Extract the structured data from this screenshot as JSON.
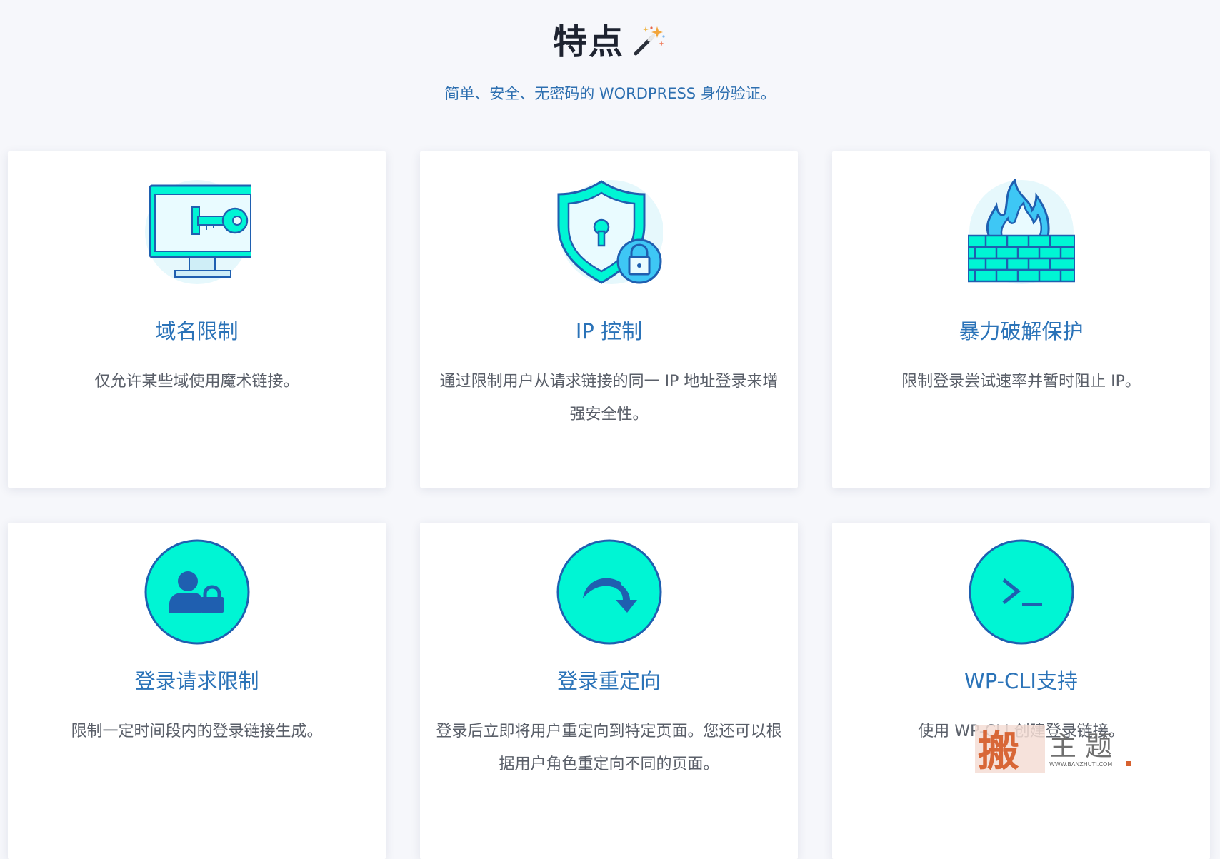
{
  "header": {
    "title": "特点",
    "subtitle": "简单、安全、无密码的 WORDPRESS 身份验证。"
  },
  "features": [
    {
      "icon": "monitor-key-icon",
      "title": "域名限制",
      "description": "仅允许某些域使用魔术链接。"
    },
    {
      "icon": "shield-lock-icon",
      "title": "IP 控制",
      "description": "通过限制用户从请求链接的同一 IP 地址登录来增强安全性。"
    },
    {
      "icon": "firewall-icon",
      "title": "暴力破解保护",
      "description": "限制登录尝试速率并暂时阻止 IP。"
    },
    {
      "icon": "user-lock-icon",
      "title": "登录请求限制",
      "description": "限制一定时间段内的登录链接生成。"
    },
    {
      "icon": "redirect-arrow-icon",
      "title": "登录重定向",
      "description": "登录后立即将用户重定向到特定页面。您还可以根据用户角色重定向不同的页面。"
    },
    {
      "icon": "terminal-icon",
      "title": "WP-CLI支持",
      "description": "使用 WP-CLI 创建登录链接。"
    }
  ],
  "watermark": {
    "logo_text": "搬主题",
    "url": "WWW.BANZHUTI.COM"
  },
  "colors": {
    "background": "#f6f7fb",
    "card_title": "#2b73b8",
    "subtitle": "#2d6fb0",
    "icon_aqua": "#00f5d4",
    "icon_stroke": "#1f5fb0",
    "icon_sky": "#3ec7f5"
  }
}
